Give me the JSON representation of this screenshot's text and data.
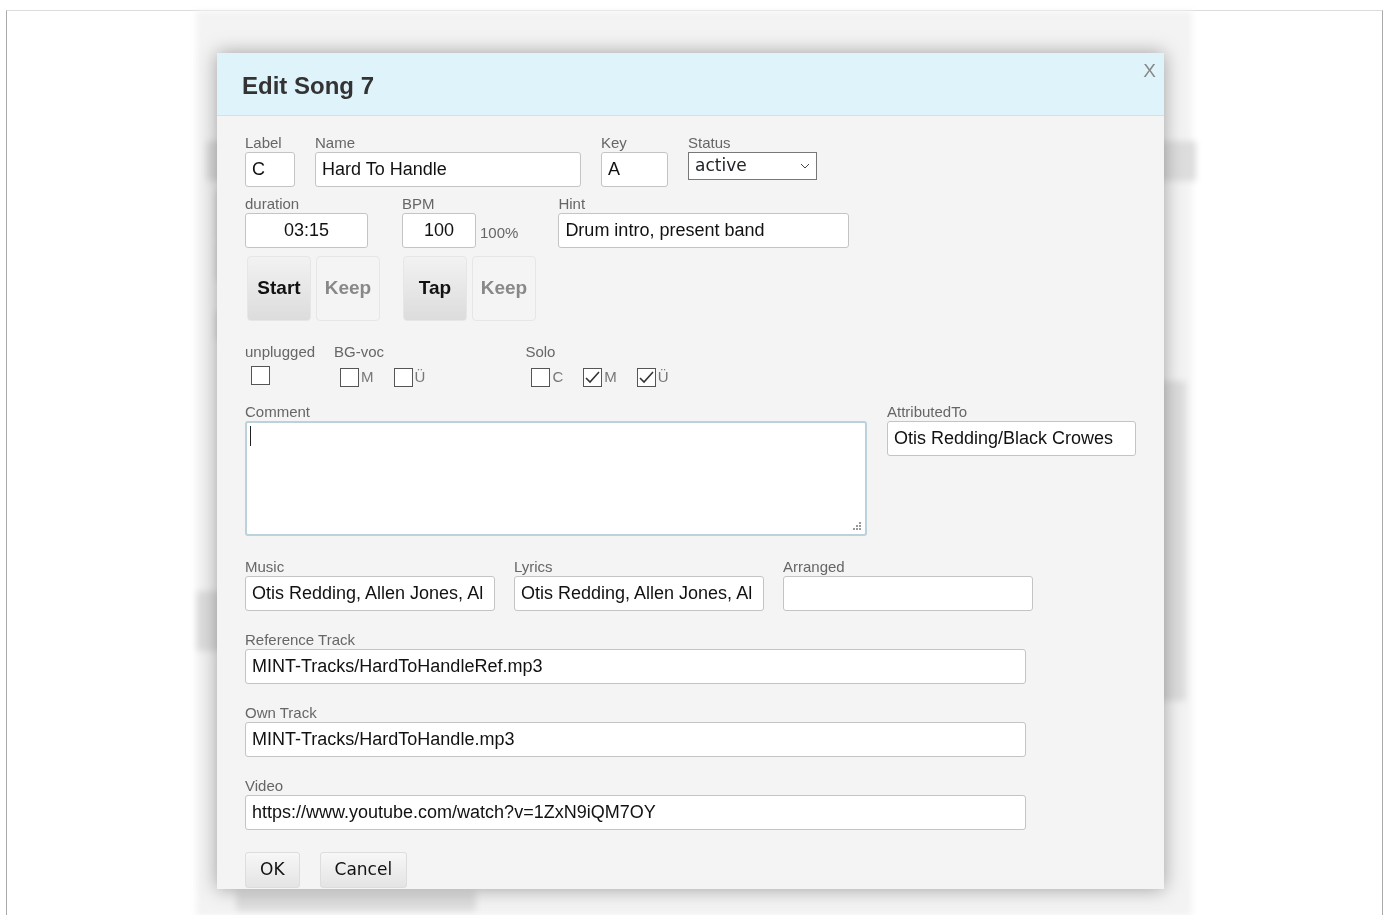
{
  "dialog": {
    "title": "Edit Song 7",
    "close": "X"
  },
  "row1": [
    {
      "label": "Label",
      "value": "C",
      "kind": "input"
    },
    {
      "label": "Name",
      "value": "Hard To Handle",
      "kind": "input"
    },
    {
      "label": "Key",
      "value": "A",
      "kind": "input"
    },
    {
      "label": "Status",
      "value": "active",
      "kind": "select"
    }
  ],
  "row2": [
    {
      "label": "duration",
      "value": "03:15"
    },
    {
      "label": "BPM",
      "value": "100",
      "suffix": "100%"
    },
    {
      "label": "Hint",
      "value": "Drum intro, present band"
    }
  ],
  "timer_buttons": [
    {
      "label": "Start",
      "disabled": false
    },
    {
      "label": "Keep",
      "disabled": true
    },
    {
      "label": "Tap",
      "disabled": false
    },
    {
      "label": "Keep",
      "disabled": true
    }
  ],
  "check_groups": [
    {
      "label": "unplugged",
      "boxes": [
        {
          "checked": false
        }
      ]
    },
    {
      "label": "BG-voc",
      "boxes": [
        {
          "label": "M",
          "checked": false
        },
        {
          "label": "Ü",
          "checked": false
        }
      ]
    },
    {
      "label": "Solo",
      "boxes": [
        {
          "label": "C",
          "checked": false
        },
        {
          "label": "M",
          "checked": true
        },
        {
          "label": "Ü",
          "checked": true
        }
      ]
    }
  ],
  "comment": {
    "label": "Comment"
  },
  "attributed_to": {
    "label": "AttributedTo",
    "value": "Otis Redding/Black Crowes"
  },
  "credits": [
    {
      "label": "Music",
      "value": "Otis Redding, Allen Jones, Al"
    },
    {
      "label": "Lyrics",
      "value": "Otis Redding, Allen Jones, Al"
    },
    {
      "label": "Arranged"
    }
  ],
  "tracks": [
    {
      "label": "Reference Track",
      "value": "MINT-Tracks/HardToHandleRef.mp3"
    },
    {
      "label": "Own Track",
      "value": "MINT-Tracks/HardToHandle.mp3"
    },
    {
      "label": "Video",
      "value": "https://www.youtube.com/watch?v=1ZxN9iQM7OY"
    }
  ],
  "buttons": [
    "OK",
    "Cancel"
  ]
}
